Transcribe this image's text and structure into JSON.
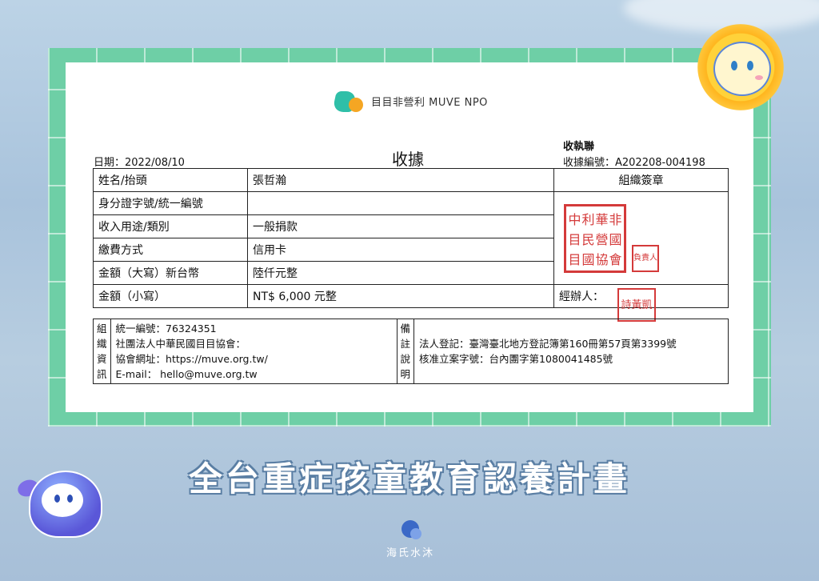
{
  "logo": {
    "text": "目目非營利 MUVE NPO"
  },
  "receipt": {
    "title": "收據",
    "date": "日期：2022/08/10",
    "copy_label": "收執聯",
    "receipt_number": "收據編號：A202208-004198",
    "rows": [
      {
        "label": "姓名/抬頭",
        "value": "張哲瀚"
      },
      {
        "label": "身分證字號/統一編號",
        "value": ""
      },
      {
        "label": "收入用途/類別",
        "value": "一般捐款"
      },
      {
        "label": "繳費方式",
        "value": "信用卡"
      },
      {
        "label": "金額（大寫）新台幣",
        "value": "陸仟元整"
      },
      {
        "label": "金額（小寫）",
        "value": "NT$ 6,000 元整"
      }
    ],
    "seal_header": "組織簽章",
    "handler_label": "經辦人：",
    "seal_chars": [
      "中",
      "利",
      "華",
      "非",
      "目",
      "民",
      "營",
      "國",
      "目",
      "國",
      "協",
      "會"
    ],
    "small_seal_chars": [
      "負",
      "責",
      "人"
    ],
    "handler_seal_chars": [
      "詩",
      "黃",
      "凱"
    ]
  },
  "org_info": {
    "side_label": [
      "組",
      "織",
      "資",
      "訊"
    ],
    "lines": [
      "統一編號：76324351",
      "社團法人中華民國目目協會：",
      "協會網址：https://muve.org.tw/",
      "E-mail： hello@muve.org.tw"
    ],
    "notes_label": [
      "備",
      "註",
      "說",
      "明"
    ],
    "notes": [
      "法人登記：臺灣臺北地方登記簿第160冊第57頁第3399號",
      "核准立案字號：台內團字第1080041485號"
    ]
  },
  "campaign_title": "全台重症孩童教育認養計畫",
  "brand_name": "海氏水沐",
  "colors": {
    "frame_green": "#6ecfa6",
    "seal_red": "#d43a3a",
    "sky": "#b7cde0"
  }
}
